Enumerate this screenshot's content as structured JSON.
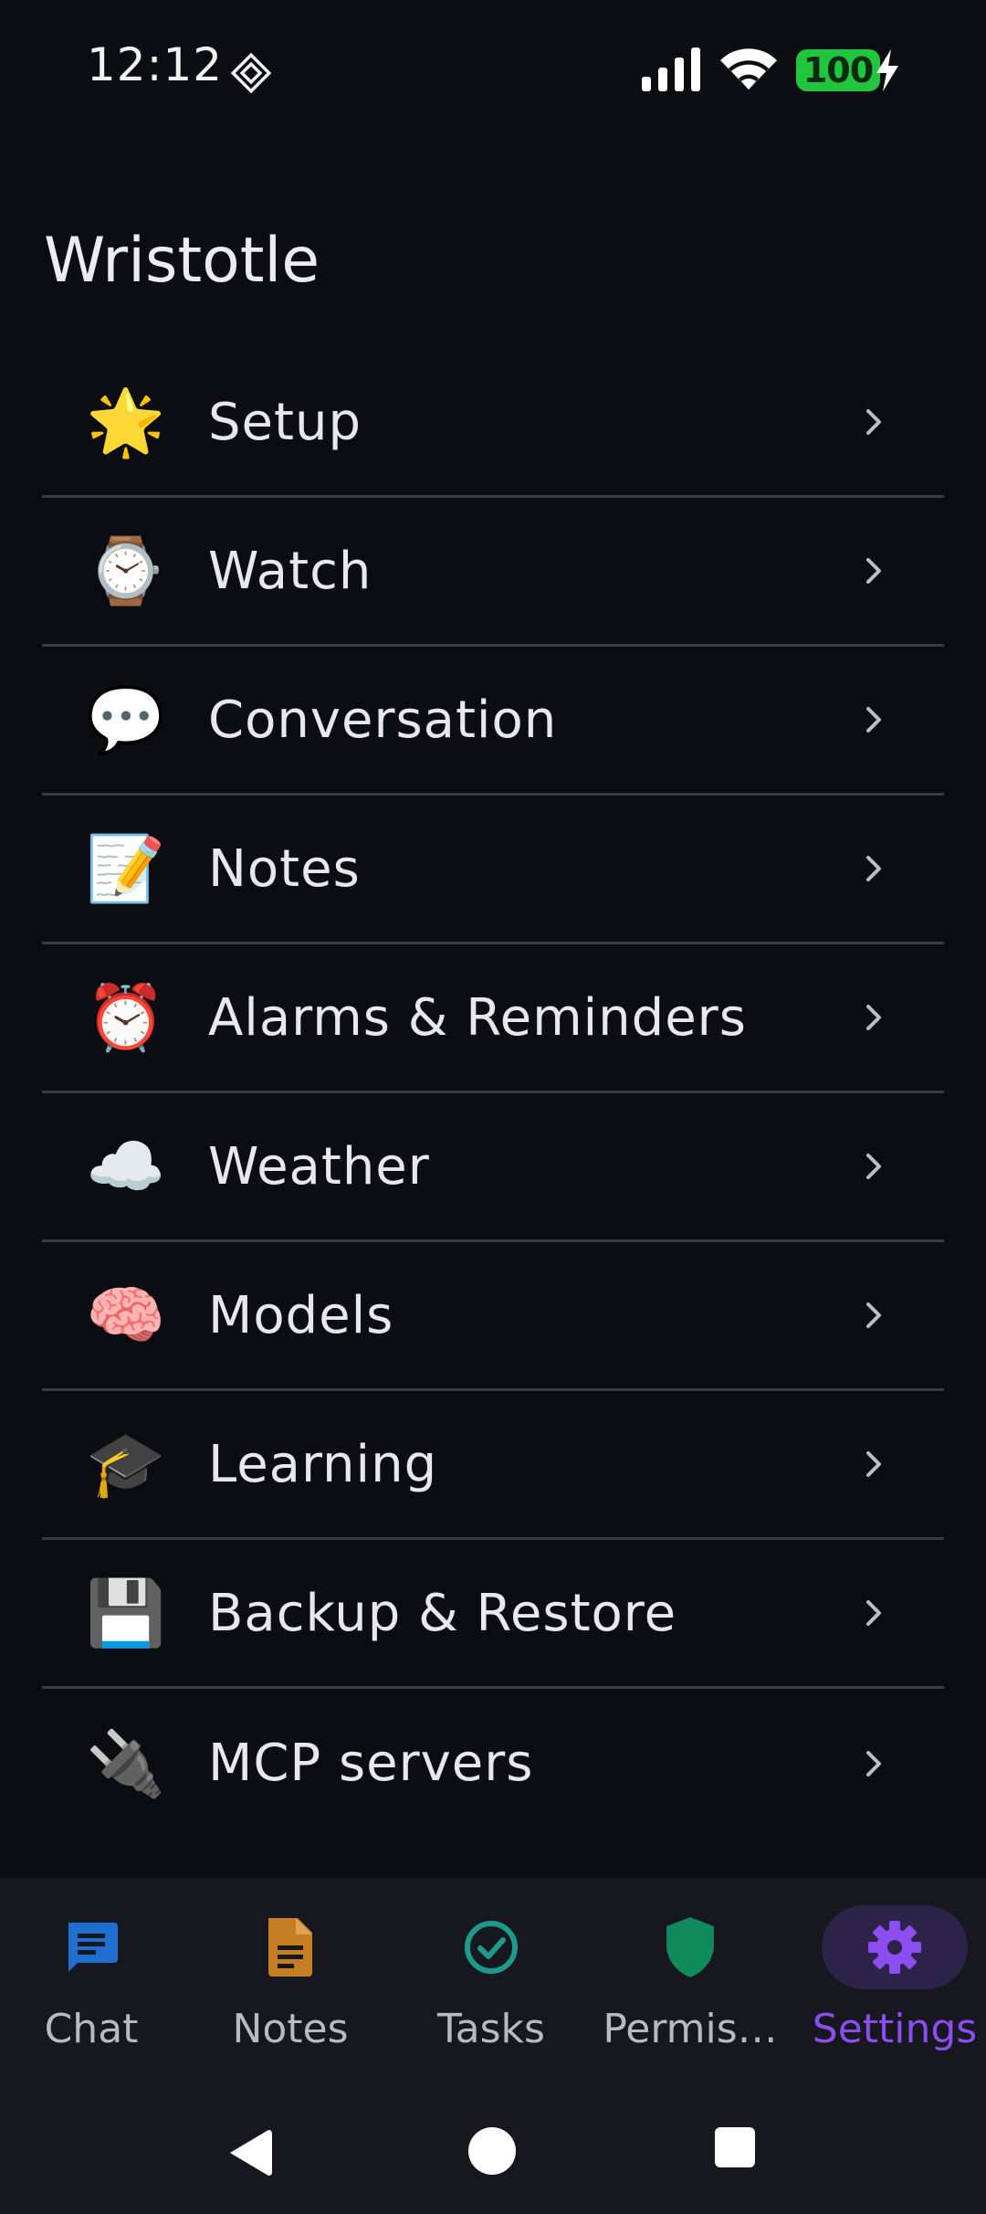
{
  "status": {
    "time": "12:12",
    "battery": "100"
  },
  "app": {
    "title": "Wristotle"
  },
  "settings": {
    "items": [
      {
        "icon": "🌟",
        "icon_name": "star-icon",
        "label": "Setup"
      },
      {
        "icon": "⌚",
        "icon_name": "watch-icon",
        "label": "Watch"
      },
      {
        "icon": "💬",
        "icon_name": "speech-bubble-icon",
        "label": "Conversation"
      },
      {
        "icon": "📝",
        "icon_name": "memo-icon",
        "label": "Notes"
      },
      {
        "icon": "⏰",
        "icon_name": "alarm-clock-icon",
        "label": "Alarms & Reminders"
      },
      {
        "icon": "☁️",
        "icon_name": "cloud-icon",
        "label": "Weather"
      },
      {
        "icon": "🧠",
        "icon_name": "brain-icon",
        "label": "Models"
      },
      {
        "icon": "🎓",
        "icon_name": "graduation-cap-icon",
        "label": "Learning"
      },
      {
        "icon": "💾",
        "icon_name": "floppy-disk-icon",
        "label": "Backup & Restore"
      },
      {
        "icon": "🔌",
        "icon_name": "plug-icon",
        "label": "MCP servers"
      }
    ]
  },
  "nav": {
    "items": [
      {
        "label": "Chat",
        "icon_name": "chat-icon",
        "color": "#1e6fd0"
      },
      {
        "label": "Notes",
        "icon_name": "note-icon",
        "color": "#c47f22"
      },
      {
        "label": "Tasks",
        "icon_name": "check-circle-icon",
        "color": "#1d9a8a"
      },
      {
        "label": "Permis…",
        "icon_name": "shield-icon",
        "color": "#0f8a5a"
      },
      {
        "label": "Settings",
        "icon_name": "gear-icon",
        "color": "#8b4cf0",
        "active": true
      }
    ]
  }
}
